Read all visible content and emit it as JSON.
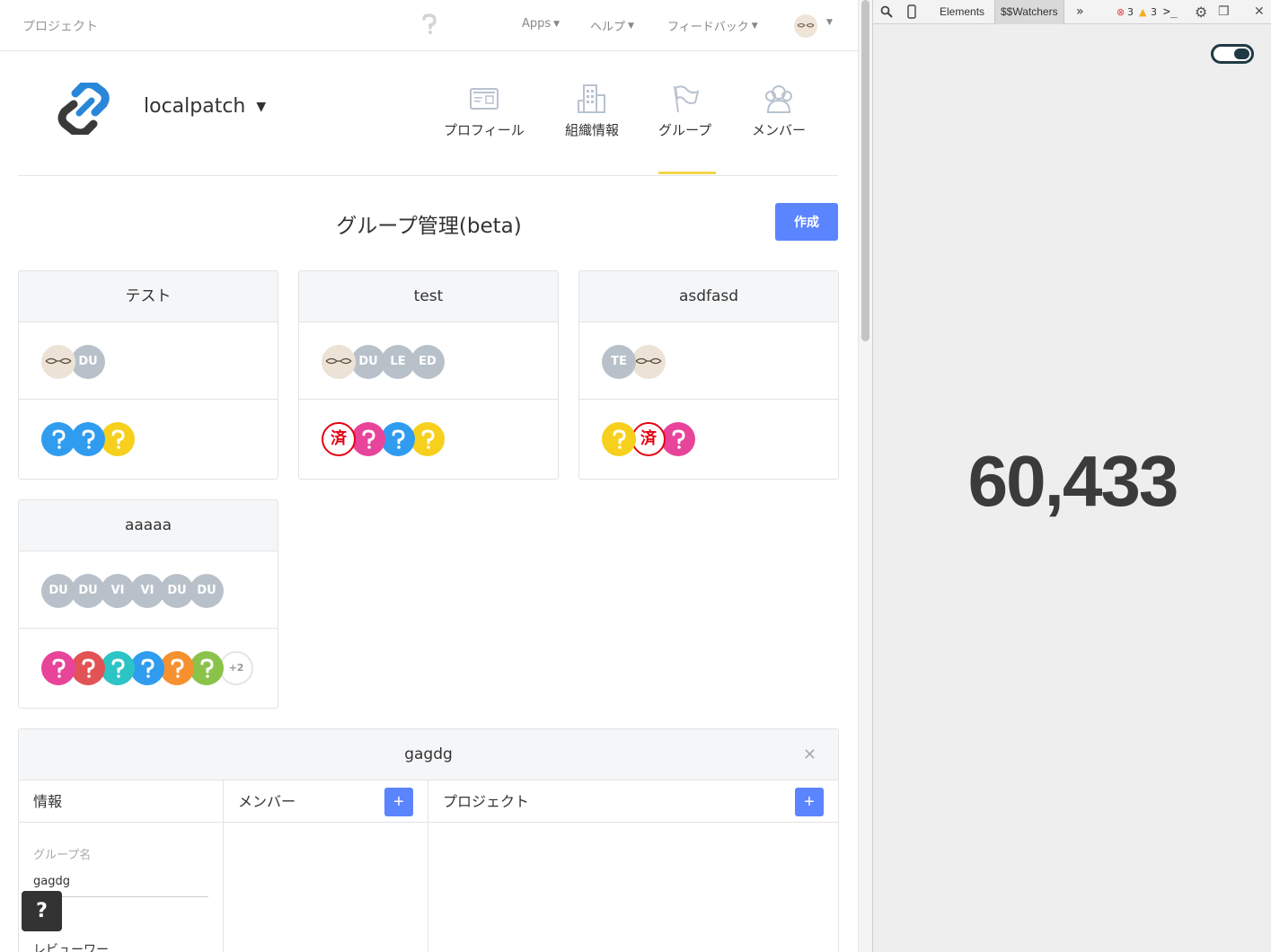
{
  "topbar": {
    "crumb": "プロジェクト",
    "menus": [
      {
        "label": "Apps"
      },
      {
        "label": "ヘルプ"
      },
      {
        "label": "フィードバック"
      }
    ]
  },
  "org": {
    "name": "localpatch",
    "tabs": [
      {
        "label": "プロフィール",
        "icon": "profile-card-icon"
      },
      {
        "label": "組織情報",
        "icon": "building-icon"
      },
      {
        "label": "グループ",
        "icon": "flag-icon",
        "active": true
      },
      {
        "label": "メンバー",
        "icon": "members-icon"
      }
    ]
  },
  "page": {
    "title": "グループ管理(beta)",
    "create_label": "作成"
  },
  "groups": [
    {
      "name": "テスト",
      "members": [
        "photo",
        "DU"
      ],
      "projects": [
        {
          "color": "#2f9cf0"
        },
        {
          "color": "#2f9cf0"
        },
        {
          "color": "#f6d01c"
        }
      ]
    },
    {
      "name": "test",
      "members": [
        "photo",
        "DU",
        "LE",
        "ED"
      ],
      "projects": [
        {
          "stamp": "済"
        },
        {
          "color": "#e8449a"
        },
        {
          "color": "#2f9cf0"
        },
        {
          "color": "#f6d01c"
        }
      ]
    },
    {
      "name": "asdfasd",
      "members": [
        "TE",
        "photo"
      ],
      "projects": [
        {
          "color": "#f6d01c"
        },
        {
          "stamp": "済"
        },
        {
          "color": "#e8449a"
        }
      ]
    },
    {
      "name": "aaaaa",
      "members": [
        "DU",
        "DU",
        "VI",
        "VI",
        "DU",
        "DU"
      ],
      "projects": [
        {
          "color": "#e8449a"
        },
        {
          "color": "#e25356"
        },
        {
          "color": "#2cc4c4"
        },
        {
          "color": "#2f9cf0"
        },
        {
          "color": "#f6912f"
        },
        {
          "color": "#8bc34a"
        },
        {
          "more": "+2"
        }
      ]
    }
  ],
  "detail": {
    "name": "gagdg",
    "col_info": "情報",
    "col_members": "メンバー",
    "col_projects": "プロジェクト",
    "group_name_label": "グループ名",
    "group_name_value": "gagdg",
    "reviewer_label": "レビューワー"
  },
  "help_label": "?",
  "devtools": {
    "tabs": [
      "Elements",
      "$$Watchers"
    ],
    "more": "»",
    "errors": "3",
    "warnings": "3",
    "watcher_count": "60,433"
  }
}
